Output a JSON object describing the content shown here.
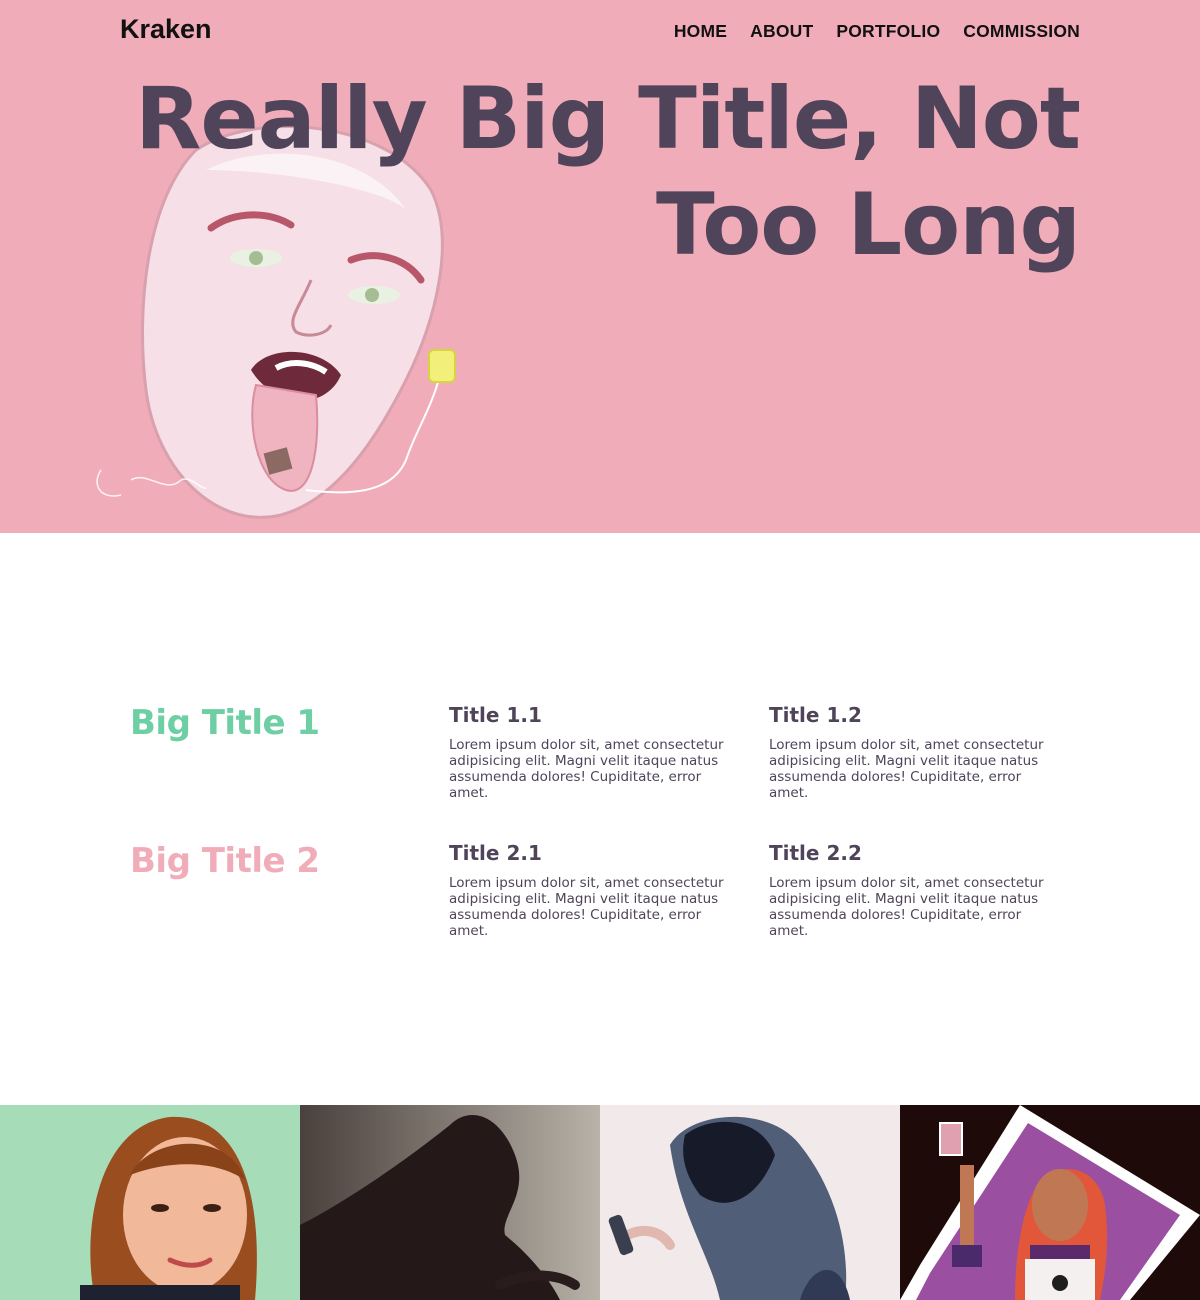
{
  "brand": "Kraken",
  "nav": {
    "home": "HOME",
    "about": "ABOUT",
    "portfolio": "PORTFOLIO",
    "commission": "COMMISSION"
  },
  "hero": {
    "title_line1": "Really Big Title, Not",
    "title_line2": "Too Long",
    "bg_color": "#f0acb9",
    "title_color": "#4f4459"
  },
  "features": {
    "rows": [
      {
        "big_title": "Big Title 1",
        "big_title_color": "#6dcfa3",
        "items": [
          {
            "title": "Title 1.1",
            "text": "Lorem ipsum dolor sit, amet consectetur adipisicing elit. Magni velit itaque natus assumenda dolores! Cupiditate, error amet."
          },
          {
            "title": "Title 1.2",
            "text": "Lorem ipsum dolor sit, amet consectetur adipisicing elit. Magni velit itaque natus assumenda dolores! Cupiditate, error amet."
          }
        ]
      },
      {
        "big_title": "Big Title 2",
        "big_title_color": "#f0acb9",
        "items": [
          {
            "title": "Title 2.1",
            "text": "Lorem ipsum dolor sit, amet consectetur adipisicing elit. Magni velit itaque natus assumenda dolores! Cupiditate, error amet."
          },
          {
            "title": "Title 2.2",
            "text": "Lorem ipsum dolor sit, amet consectetur adipisicing elit. Magni velit itaque natus assumenda dolores! Cupiditate, error amet."
          }
        ]
      }
    ]
  },
  "gallery": {
    "tiles": [
      {
        "bg": "#a7dcb8"
      },
      {
        "bg": "#7d7670"
      },
      {
        "bg": "#f2e9ea"
      },
      {
        "bg": "#1e0a08"
      }
    ]
  }
}
